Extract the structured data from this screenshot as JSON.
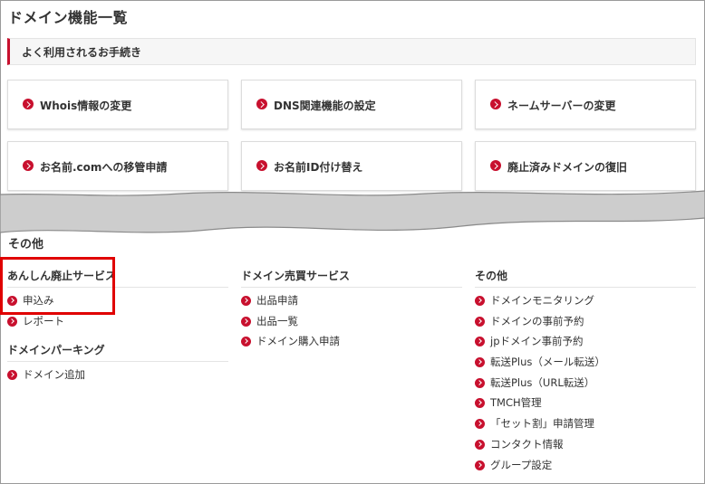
{
  "page": {
    "title": "ドメイン機能一覧"
  },
  "quick": {
    "header": "よく利用されるお手続き",
    "items": [
      {
        "label": "Whois情報の変更"
      },
      {
        "label": "DNS関連機能の設定"
      },
      {
        "label": "ネームサーバーの変更"
      },
      {
        "label": "お名前.comへの移管申請"
      },
      {
        "label": "お名前ID付け替え"
      },
      {
        "label": "廃止済みドメインの復旧"
      }
    ]
  },
  "other": {
    "title": "その他",
    "col1": {
      "head": "あんしん廃止サービス",
      "items": [
        {
          "label": "申込み"
        },
        {
          "label": "レポート"
        }
      ],
      "head2": "ドメインパーキング",
      "items2": [
        {
          "label": "ドメイン追加"
        }
      ]
    },
    "col2": {
      "head": "ドメイン売買サービス",
      "items": [
        {
          "label": "出品申請"
        },
        {
          "label": "出品一覧"
        },
        {
          "label": "ドメイン購入申請"
        }
      ]
    },
    "col3": {
      "head": "その他",
      "items": [
        {
          "label": "ドメインモニタリング"
        },
        {
          "label": "ドメインの事前予約"
        },
        {
          "label": "jpドメイン事前予約"
        },
        {
          "label": "転送Plus（メール転送）"
        },
        {
          "label": "転送Plus（URL転送）"
        },
        {
          "label": "TMCH管理"
        },
        {
          "label": "「セット割」申請管理"
        },
        {
          "label": "コンタクト情報"
        },
        {
          "label": "グループ設定"
        }
      ]
    }
  },
  "colors": {
    "accent": "#c8102e",
    "highlight": "#e00000",
    "torn_gray": "#cdcdcd"
  },
  "icons": {
    "item_icon": "chevron-right-circle-icon"
  }
}
